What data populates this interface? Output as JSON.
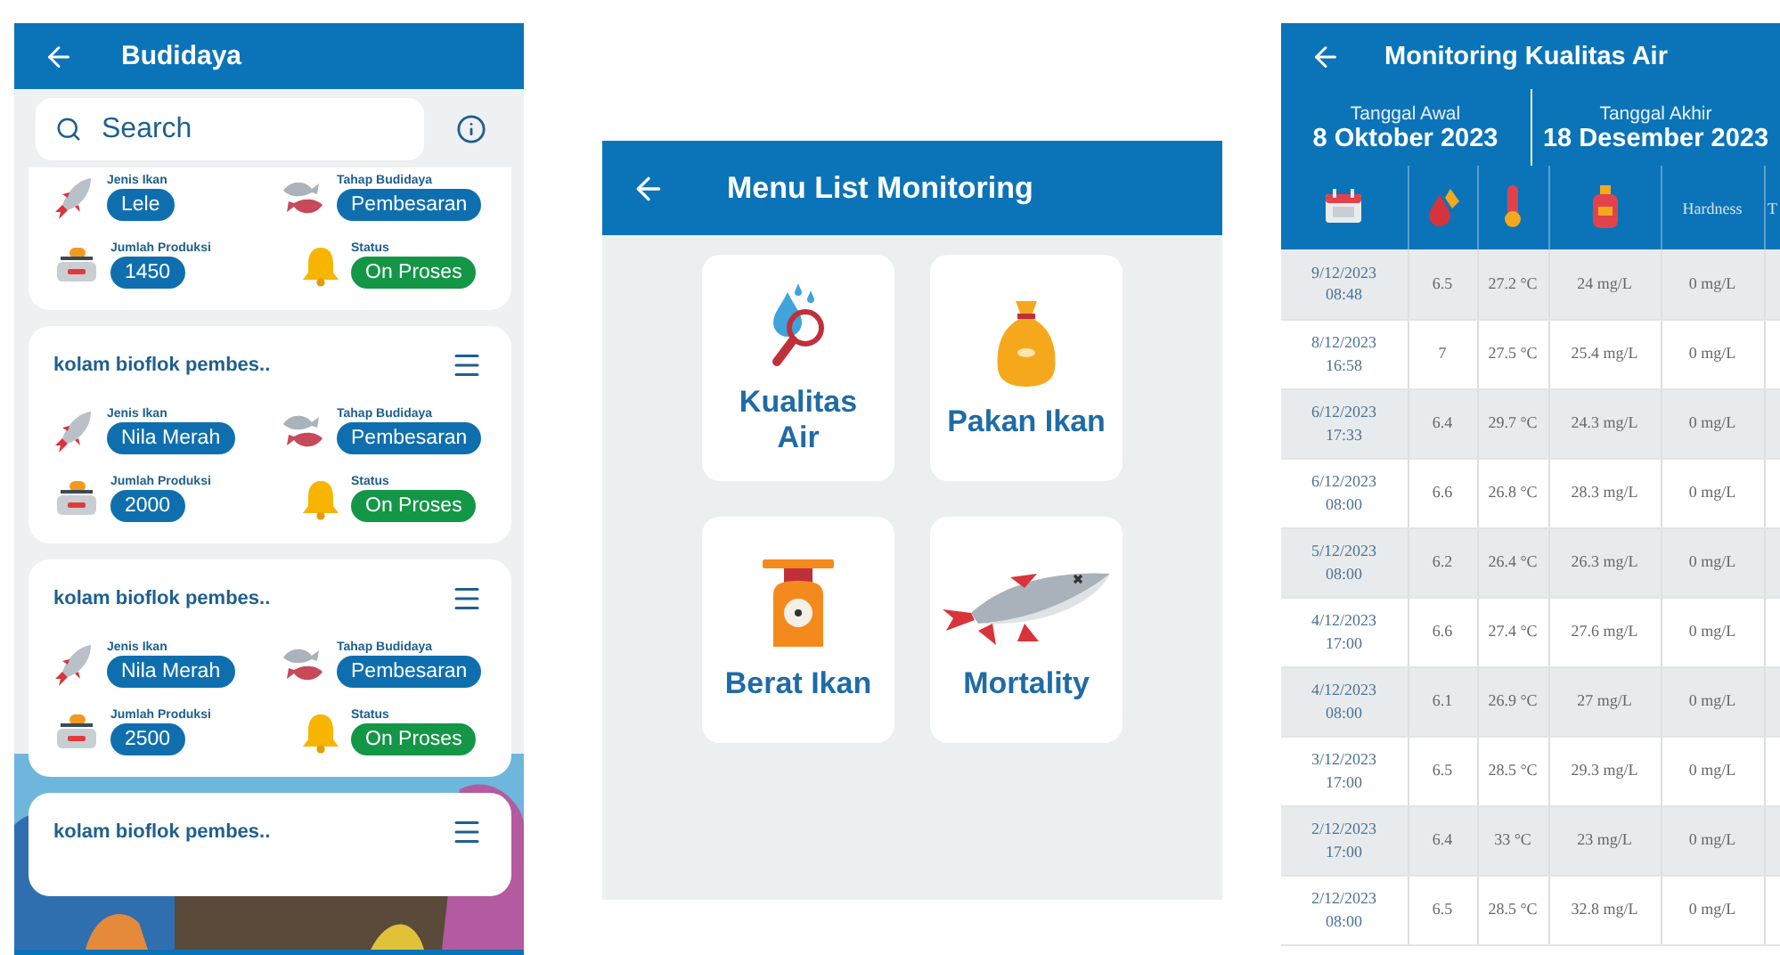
{
  "budidaya": {
    "title": "Budidaya",
    "search": {
      "placeholder": "Search"
    },
    "cards": [
      {
        "fields": [
          {
            "kind": "fish",
            "label": "Jenis Ikan",
            "value": "Lele"
          },
          {
            "kind": "stage",
            "label": "Tahap Budidaya",
            "value": "Pembesaran"
          },
          {
            "kind": "production",
            "label": "Jumlah Produksi",
            "value": "1450"
          },
          {
            "kind": "status",
            "label": "Status",
            "value": "On Proses"
          }
        ]
      },
      {
        "title": "kolam bioflok pembes..",
        "fields": [
          {
            "kind": "fish",
            "label": "Jenis Ikan",
            "value": "Nila Merah"
          },
          {
            "kind": "stage",
            "label": "Tahap Budidaya",
            "value": "Pembesaran"
          },
          {
            "kind": "production",
            "label": "Jumlah Produksi",
            "value": "2000"
          },
          {
            "kind": "status",
            "label": "Status",
            "value": "On Proses"
          }
        ]
      },
      {
        "title": "kolam bioflok pembes..",
        "fields": [
          {
            "kind": "fish",
            "label": "Jenis Ikan",
            "value": "Nila Merah"
          },
          {
            "kind": "stage",
            "label": "Tahap Budidaya",
            "value": "Pembesaran"
          },
          {
            "kind": "production",
            "label": "Jumlah Produksi",
            "value": "2500"
          },
          {
            "kind": "status",
            "label": "Status",
            "value": "On Proses"
          }
        ]
      },
      {
        "title": "kolam bioflok pembes.."
      }
    ]
  },
  "menu": {
    "title": "Menu List Monitoring",
    "tiles": [
      {
        "kind": "water",
        "label": "Kualitas Air"
      },
      {
        "kind": "feed",
        "label": "Pakan Ikan"
      },
      {
        "kind": "weight",
        "label": "Berat Ikan"
      },
      {
        "kind": "mortality",
        "label": "Mortality"
      }
    ]
  },
  "monitoring": {
    "title": "Monitoring Kualitas Air",
    "dates": [
      {
        "label": "Tanggal Awal",
        "value": "8 Oktober 2023"
      },
      {
        "label": "Tanggal Akhir",
        "value": "18 Desember 2023"
      }
    ],
    "table": {
      "columns": [
        {
          "kind": "date"
        },
        {
          "kind": "ph"
        },
        {
          "kind": "temperature"
        },
        {
          "kind": "oxygen"
        },
        {
          "kind": "text",
          "label": "Hardness"
        },
        {
          "kind": "text",
          "label": "T"
        }
      ],
      "rows": [
        {
          "date": "9/12/2023\n08:48",
          "ph": "6.5",
          "temperature": "27.2 °C",
          "oxygen": "24 mg/L",
          "hardness": "0 mg/L"
        },
        {
          "date": "8/12/2023\n16:58",
          "ph": "7",
          "temperature": "27.5 °C",
          "oxygen": "25.4 mg/L",
          "hardness": "0 mg/L"
        },
        {
          "date": "6/12/2023\n17:33",
          "ph": "6.4",
          "temperature": "29.7 °C",
          "oxygen": "24.3 mg/L",
          "hardness": "0 mg/L"
        },
        {
          "date": "6/12/2023\n08:00",
          "ph": "6.6",
          "temperature": "26.8 °C",
          "oxygen": "28.3 mg/L",
          "hardness": "0 mg/L"
        },
        {
          "date": "5/12/2023\n08:00",
          "ph": "6.2",
          "temperature": "26.4 °C",
          "oxygen": "26.3 mg/L",
          "hardness": "0 mg/L"
        },
        {
          "date": "4/12/2023\n17:00",
          "ph": "6.6",
          "temperature": "27.4 °C",
          "oxygen": "27.6 mg/L",
          "hardness": "0 mg/L"
        },
        {
          "date": "4/12/2023\n08:00",
          "ph": "6.1",
          "temperature": "26.9 °C",
          "oxygen": "27 mg/L",
          "hardness": "0 mg/L"
        },
        {
          "date": "3/12/2023\n17:00",
          "ph": "6.5",
          "temperature": "28.5 °C",
          "oxygen": "29.3 mg/L",
          "hardness": "0 mg/L"
        },
        {
          "date": "2/12/2023\n17:00",
          "ph": "6.4",
          "temperature": "33 °C",
          "oxygen": "23 mg/L",
          "hardness": "0 mg/L"
        },
        {
          "date": "2/12/2023\n08:00",
          "ph": "6.5",
          "temperature": "28.5 °C",
          "oxygen": "32.8 mg/L",
          "hardness": "0 mg/L"
        }
      ]
    }
  }
}
